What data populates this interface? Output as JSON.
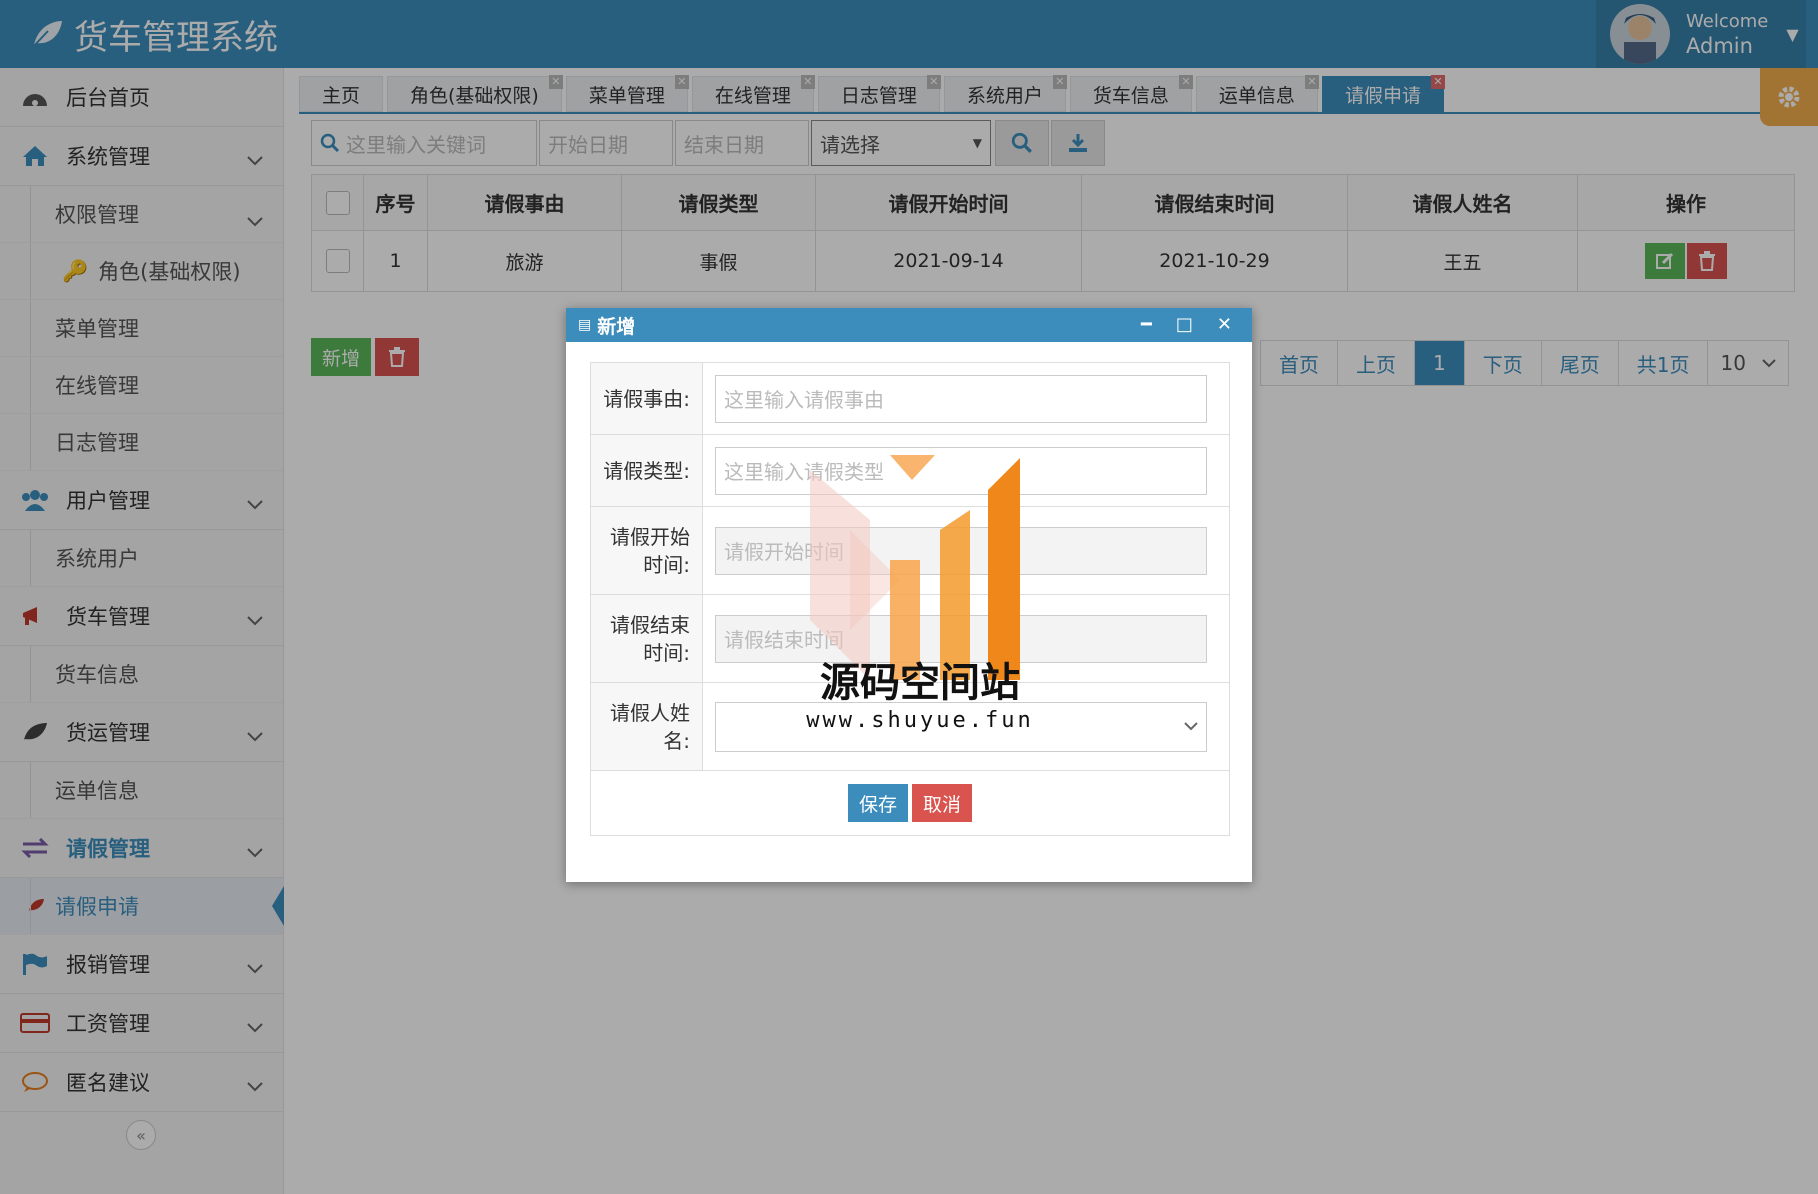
{
  "app": {
    "title": "货车管理系统"
  },
  "user": {
    "welcome": "Welcome",
    "name": "Admin"
  },
  "sidebar": {
    "items": [
      {
        "label": "后台首页"
      },
      {
        "label": "系统管理"
      },
      {
        "label": "权限管理"
      },
      {
        "label": "角色(基础权限)"
      },
      {
        "label": "菜单管理"
      },
      {
        "label": "在线管理"
      },
      {
        "label": "日志管理"
      },
      {
        "label": "用户管理"
      },
      {
        "label": "系统用户"
      },
      {
        "label": "货车管理"
      },
      {
        "label": "货车信息"
      },
      {
        "label": "货运管理"
      },
      {
        "label": "运单信息"
      },
      {
        "label": "请假管理"
      },
      {
        "label": "请假申请"
      },
      {
        "label": "报销管理"
      },
      {
        "label": "工资管理"
      },
      {
        "label": "匿名建议"
      }
    ],
    "collapse": "«"
  },
  "tabs": [
    {
      "label": "主页"
    },
    {
      "label": "角色(基础权限)"
    },
    {
      "label": "菜单管理"
    },
    {
      "label": "在线管理"
    },
    {
      "label": "日志管理"
    },
    {
      "label": "系统用户"
    },
    {
      "label": "货车信息"
    },
    {
      "label": "运单信息"
    },
    {
      "label": "请假申请"
    }
  ],
  "toolbar": {
    "keyword_placeholder": "这里输入关键词",
    "start_placeholder": "开始日期",
    "end_placeholder": "结束日期",
    "select_value": "请选择"
  },
  "table": {
    "headers": [
      "序号",
      "请假事由",
      "请假类型",
      "请假开始时间",
      "请假结束时间",
      "请假人姓名",
      "操作"
    ],
    "rows": [
      {
        "no": "1",
        "reason": "旅游",
        "type": "事假",
        "start": "2021-09-14",
        "end": "2021-10-29",
        "name": "王五"
      }
    ]
  },
  "actions": {
    "add": "新增"
  },
  "pager": {
    "first": "首页",
    "prev": "上页",
    "current": "1",
    "next": "下页",
    "last": "尾页",
    "total": "共1页",
    "size": "10"
  },
  "modal": {
    "title": "新增",
    "fields": [
      {
        "label": "请假事由:",
        "placeholder": "这里输入请假事由"
      },
      {
        "label": "请假类型:",
        "placeholder": "这里输入请假类型"
      },
      {
        "label": "请假开始时间:",
        "placeholder": "请假开始时间"
      },
      {
        "label": "请假结束时间:",
        "placeholder": "请假结束时间"
      },
      {
        "label": "请假人姓名:",
        "placeholder": ""
      }
    ],
    "save": "保存",
    "cancel": "取消"
  },
  "watermark": {
    "title": "源码空间站",
    "url": "www.shuyue.fun"
  },
  "colors": {
    "primary": "#3c8dbc",
    "success": "#5cb85c",
    "danger": "#d9534f",
    "warning": "#f0ad4e"
  }
}
